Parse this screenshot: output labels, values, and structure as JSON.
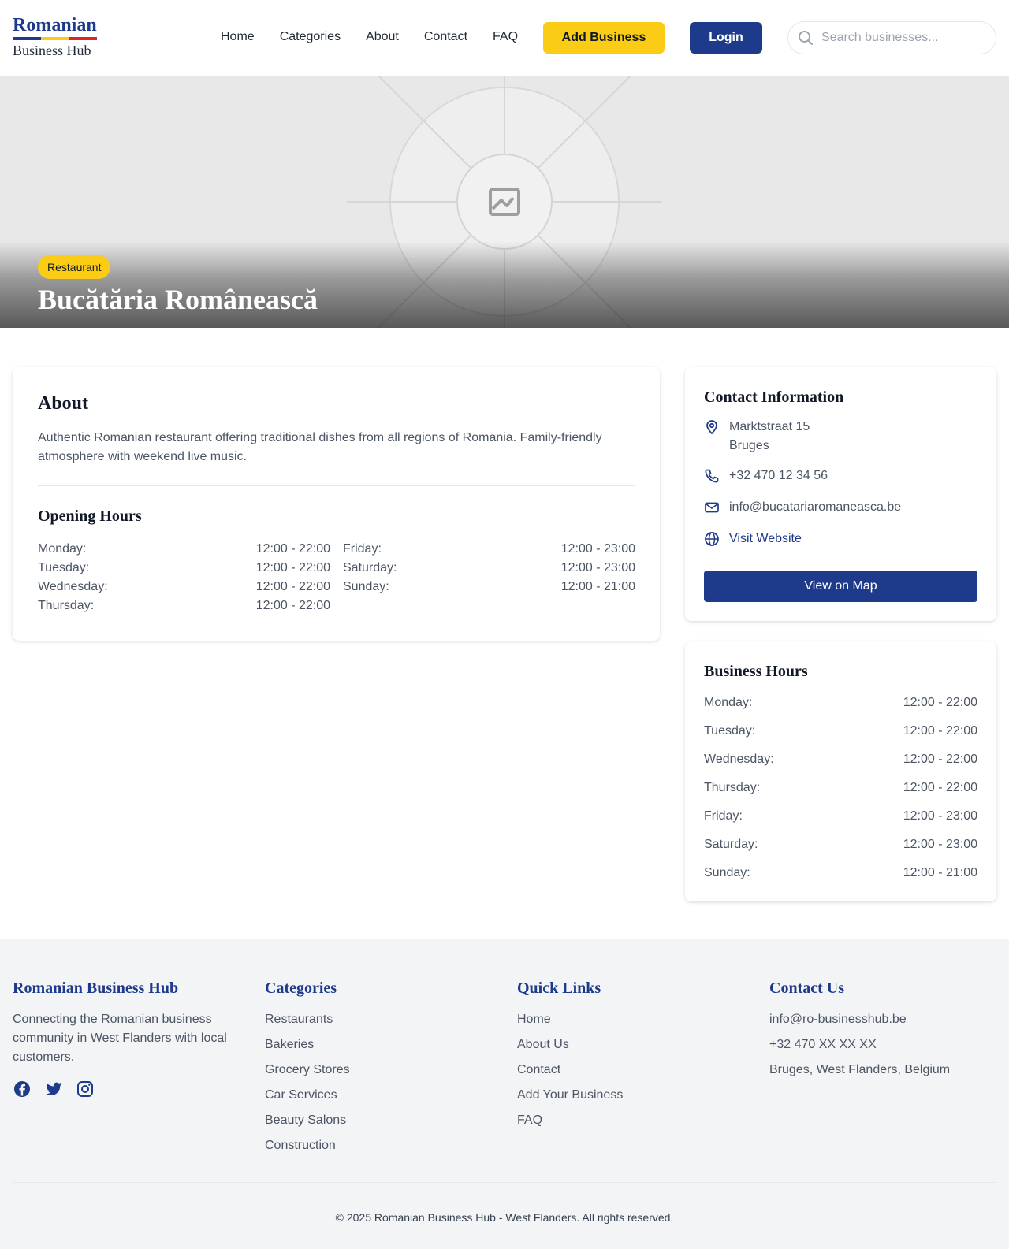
{
  "colors": {
    "primary": "#1e3a8a",
    "accent": "#facc15",
    "flag_blue": "#1e3a8a",
    "flag_yellow": "#facc15",
    "flag_red": "#dc2626"
  },
  "header": {
    "logo_top": "Romanian",
    "logo_bottom": "Business Hub",
    "nav": [
      "Home",
      "Categories",
      "About",
      "Contact",
      "FAQ"
    ],
    "add_business": "Add Business",
    "login": "Login",
    "search_placeholder": "Search businesses..."
  },
  "hero": {
    "icon": "image-placeholder-icon",
    "category": "Restaurant",
    "title": "Bucătăria Românească"
  },
  "about": {
    "title": "About",
    "description": "Authentic Romanian restaurant offering traditional dishes from all regions of Romania. Family-friendly atmosphere with weekend live music.",
    "hours_title": "Opening Hours",
    "hours_left": [
      {
        "day": "Monday:",
        "time": "12:00 - 22:00"
      },
      {
        "day": "Tuesday:",
        "time": "12:00 - 22:00"
      },
      {
        "day": "Wednesday:",
        "time": "12:00 - 22:00"
      },
      {
        "day": "Thursday:",
        "time": "12:00 - 22:00"
      }
    ],
    "hours_right": [
      {
        "day": "Friday:",
        "time": "12:00 - 23:00"
      },
      {
        "day": "Saturday:",
        "time": "12:00 - 23:00"
      },
      {
        "day": "Sunday:",
        "time": "12:00 - 21:00"
      }
    ]
  },
  "contact": {
    "title": "Contact Information",
    "address_line1": "Marktstraat 15",
    "address_line2": "Bruges",
    "phone": "+32 470 12 34 56",
    "email": "info@bucatariaromaneasca.be",
    "website": "Visit Website",
    "map_button": "View on Map"
  },
  "business_hours": {
    "title": "Business Hours",
    "rows": [
      {
        "day": "Monday:",
        "time": "12:00 - 22:00"
      },
      {
        "day": "Tuesday:",
        "time": "12:00 - 22:00"
      },
      {
        "day": "Wednesday:",
        "time": "12:00 - 22:00"
      },
      {
        "day": "Thursday:",
        "time": "12:00 - 22:00"
      },
      {
        "day": "Friday:",
        "time": "12:00 - 23:00"
      },
      {
        "day": "Saturday:",
        "time": "12:00 - 23:00"
      },
      {
        "day": "Sunday:",
        "time": "12:00 - 21:00"
      }
    ]
  },
  "footer": {
    "brand_title": "Romanian Business Hub",
    "brand_text": "Connecting the Romanian business community in West Flanders with local customers.",
    "socials": [
      "facebook-icon",
      "twitter-icon",
      "instagram-icon"
    ],
    "categories_title": "Categories",
    "categories": [
      "Restaurants",
      "Bakeries",
      "Grocery Stores",
      "Car Services",
      "Beauty Salons",
      "Construction"
    ],
    "quick_title": "Quick Links",
    "quick_links": [
      "Home",
      "About Us",
      "Contact",
      "Add Your Business",
      "FAQ"
    ],
    "contact_title": "Contact Us",
    "contact_lines": [
      "info@ro-businesshub.be",
      "+32 470 XX XX XX",
      "Bruges, West Flanders, Belgium"
    ],
    "copyright": "© 2025 Romanian Business Hub - West Flanders. All rights reserved."
  }
}
